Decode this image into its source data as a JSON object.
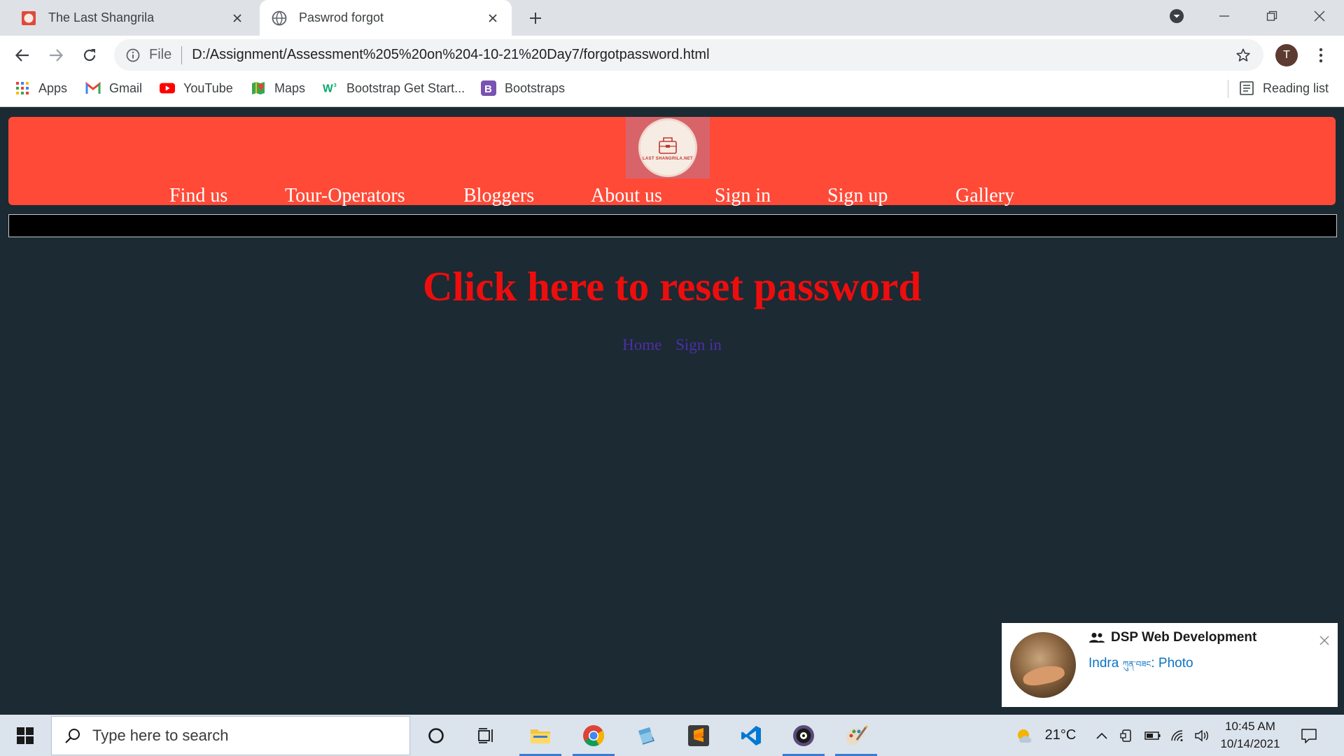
{
  "browser": {
    "tabs": [
      {
        "title": "The Last Shangrila",
        "active": false
      },
      {
        "title": "Paswrod forgot",
        "active": true
      }
    ],
    "address": {
      "scheme_label": "File",
      "url": "D:/Assignment/Assessment%205%20on%204-10-21%20Day7/forgotpassword.html"
    },
    "profile_initial": "T",
    "bookmarks": [
      {
        "label": "Apps",
        "icon": "apps-grid-icon"
      },
      {
        "label": "Gmail",
        "icon": "gmail-icon"
      },
      {
        "label": "YouTube",
        "icon": "youtube-icon"
      },
      {
        "label": "Maps",
        "icon": "maps-icon"
      },
      {
        "label": "Bootstrap Get Start...",
        "icon": "w3schools-icon"
      },
      {
        "label": "Bootstraps",
        "icon": "bootstrap-icon"
      }
    ],
    "reading_list": "Reading list"
  },
  "page": {
    "header": {
      "logo_text": "LAST SHANGRILA.NET",
      "nav": [
        "Find us",
        "Tour-Operators",
        "Bloggers",
        "About us",
        "Sign in",
        "Sign up",
        "Gallery"
      ]
    },
    "heading": "Click here to reset password",
    "links": [
      "Home",
      "Sign in"
    ],
    "colors": {
      "page_bg": "#1b2a33",
      "header_bg": "#ff4a37",
      "heading": "#ee0d0d",
      "links": "#4f2ea6"
    }
  },
  "notification": {
    "group": "DSP Web Development",
    "sender": "Indra",
    "sender_suffix": "ཀུན་བཟང",
    "message": ": Photo"
  },
  "taskbar": {
    "search_placeholder": "Type here to search",
    "weather": "21°C",
    "time": "10:45 AM",
    "date": "10/14/2021"
  }
}
